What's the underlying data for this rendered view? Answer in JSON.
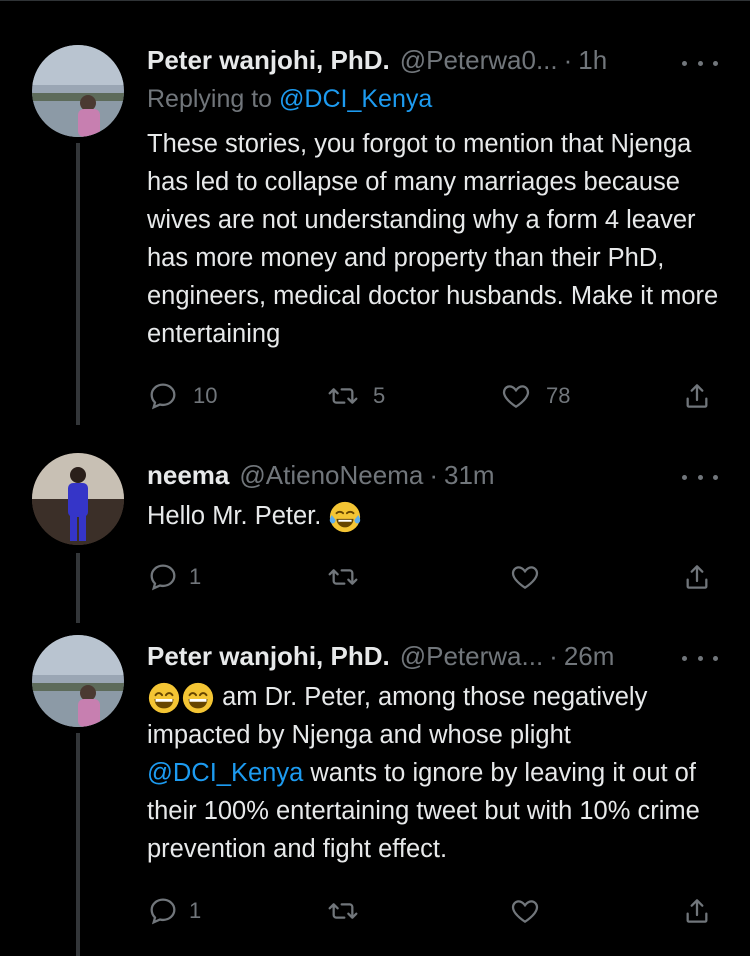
{
  "tweets": [
    {
      "name": "Peter wanjohi, PhD.",
      "handle": "@Peterwa0...",
      "separator": "·",
      "time": "1h",
      "reply_prefix": "Replying to ",
      "reply_mention": "@DCI_Kenya",
      "text": "These stories, you forgot to mention that Njenga has led to collapse of many marriages because wives are not understanding why a form 4 leaver has more money and property than their PhD, engineers, medical doctor husbands. Make it more entertaining",
      "replies": "10",
      "retweets": "5",
      "likes": "78"
    },
    {
      "name": "neema",
      "handle": "@AtienoNeema",
      "separator": "·",
      "time": "31m",
      "text": "Hello Mr. Peter.",
      "replies": "1",
      "retweets": "",
      "likes": ""
    },
    {
      "name": "Peter wanjohi, PhD.",
      "handle": "@Peterwa...",
      "separator": "·",
      "time": "26m",
      "text_part1": "am Dr. Peter, among those negatively impacted by Njenga and whose plight",
      "mention": "@DCI_Kenya",
      "text_part2": "wants to ignore by leaving it out of their 100% entertaining tweet but with 10% crime prevention and fight effect.",
      "replies": "1",
      "retweets": "",
      "likes": ""
    }
  ],
  "icons": {
    "reply": "reply-icon",
    "retweet": "retweet-icon",
    "like": "heart-icon",
    "share": "share-icon",
    "more": "more-icon"
  },
  "colors": {
    "background": "#000000",
    "text": "#e7e9ea",
    "secondary": "#71767b",
    "link": "#1d9bf0"
  }
}
